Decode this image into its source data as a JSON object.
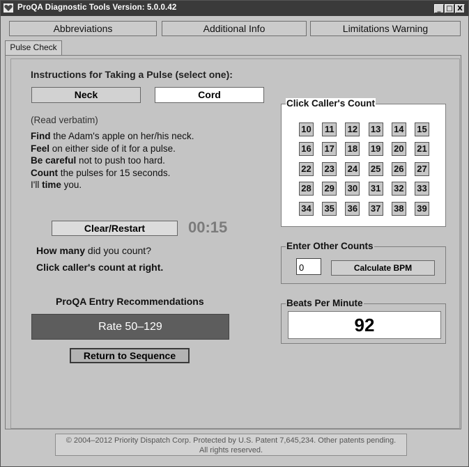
{
  "window": {
    "title": "ProQA Diagnostic Tools Version: 5.0.0.42",
    "minimize_glyph": "_",
    "maximize_glyph": "□",
    "close_glyph": "X"
  },
  "top_buttons": {
    "abbreviations": "Abbreviations",
    "additional_info": "Additional Info",
    "limitations_warning": "Limitations Warning"
  },
  "tab": {
    "label": "Pulse Check"
  },
  "instructions": {
    "title": "Instructions for Taking a Pulse (select one):",
    "options": [
      "Neck",
      "Cord"
    ],
    "selected": "Cord",
    "verbatim_note": "(Read verbatim)",
    "lines": [
      {
        "bold": "Find",
        "rest": " the Adam's apple on her/his neck."
      },
      {
        "bold": "Feel",
        "rest": " on either side of it for a pulse."
      },
      {
        "bold": "Be careful",
        "rest": " not to push too hard."
      },
      {
        "bold": "Count",
        "rest": " the pulses for 15 seconds."
      },
      {
        "prefix": "I'll ",
        "bold": "time",
        "rest": " you."
      }
    ]
  },
  "timer": {
    "clear_label": "Clear/Restart",
    "value": "00:15"
  },
  "question": {
    "bold": "How many",
    "rest": " did you count?",
    "prompt": "Click caller's count at right."
  },
  "recommendations": {
    "title": "ProQA Entry Recommendations",
    "rate": "Rate 50–129",
    "return_label": "Return to Sequence"
  },
  "callers_count": {
    "title": "Click Caller's Count",
    "values": [
      10,
      11,
      12,
      13,
      14,
      15,
      16,
      17,
      18,
      19,
      20,
      21,
      22,
      23,
      24,
      25,
      26,
      27,
      28,
      29,
      30,
      31,
      32,
      33,
      34,
      35,
      36,
      37,
      38,
      39
    ]
  },
  "other_counts": {
    "title": "Enter Other Counts",
    "value": "0",
    "calc_label": "Calculate BPM"
  },
  "bpm": {
    "title": "Beats Per Minute",
    "value": "92"
  },
  "footer": {
    "line1": "© 2004–2012 Priority Dispatch Corp. Protected by U.S. Patent 7,645,234. Other patents pending.",
    "line2": "All rights reserved."
  },
  "colors": {
    "titlebar": "#3a3a3a",
    "panel_bg": "#c4c4c4",
    "rate_bg": "#5d5d5d",
    "timer_text": "#7b7b7b"
  }
}
